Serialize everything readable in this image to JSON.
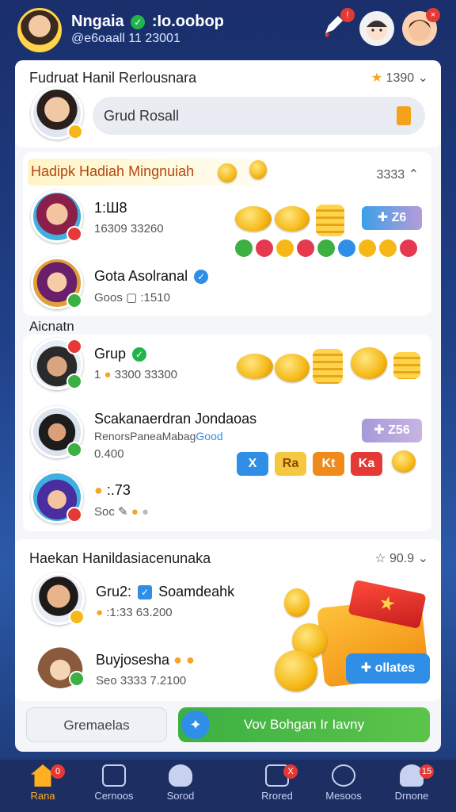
{
  "header": {
    "name": "Nngaia",
    "name_suffix": ":Io.oobop",
    "subtitle": "@e6oaall 11 23001"
  },
  "card1": {
    "title": "Fudruat Hanil Rerlousnara",
    "rating": "1390",
    "search_value": "Grud Rosall"
  },
  "card2": {
    "title": "Hadipk Hadiah Mingnuiah",
    "meta": "3333",
    "row1": {
      "name": "1:Ш8",
      "sub": "16309 33260"
    },
    "row2": {
      "name": "Gota Asolranal",
      "sub": "Goos",
      "sub2": ":1510"
    },
    "button_label": "Z6"
  },
  "section3": {
    "label": "Aicnatn",
    "row1": {
      "name": "Grup",
      "sub": "1",
      "sub2": "3300 33300"
    },
    "row2": {
      "name": "Scakanaerdran Jondaoas",
      "sub": "RenorsPaneaMabag",
      "sub_link": "Good",
      "sub3": "0.400"
    },
    "row3": {
      "name": ":.73",
      "sub": "Soc"
    },
    "button_label": "Z56",
    "tag_labels": [
      "X",
      "Ra",
      "Kt",
      "Ka"
    ]
  },
  "card4": {
    "title": "Haekan Hanildasiacenunaka",
    "meta": "90.9",
    "row1": {
      "name": "Gru2:",
      "name_suffix": "Soamdeahk",
      "sub": ":1:33 63.200"
    },
    "row2": {
      "name": "Buyjosesha",
      "sub": "Seo 3333 7.2100"
    },
    "open_button": "ollates"
  },
  "footer": {
    "secondary_button": "Gremaelas",
    "primary_button": "Vov Bohgan Ir Iavny"
  },
  "nav": {
    "items": [
      {
        "label": "Rana",
        "badge": "0"
      },
      {
        "label": "Cernoos",
        "badge": ""
      },
      {
        "label": "Sorod",
        "badge": ""
      },
      {
        "label": "Rrored",
        "badge": "X"
      },
      {
        "label": "Mesoos",
        "badge": ""
      },
      {
        "label": "Drnone",
        "badge": "15"
      }
    ]
  },
  "colors": {
    "accent_green": "#3cb043",
    "accent_blue": "#2f8fe6",
    "gold": "#f5b816",
    "nav_active": "#ffb020"
  }
}
